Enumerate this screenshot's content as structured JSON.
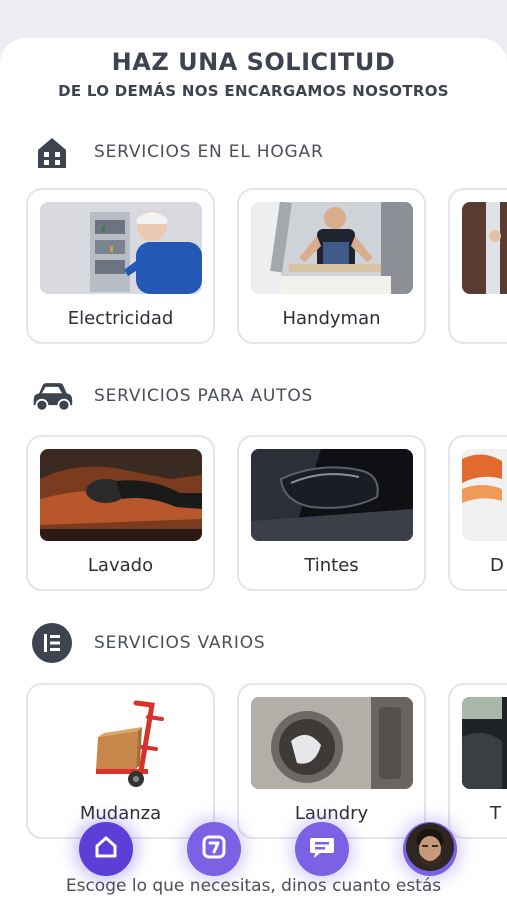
{
  "header": {
    "title": "HAZ UNA SOLICITUD",
    "subtitle": "DE LO DEMÁS NOS ENCARGAMOS NOSOTROS"
  },
  "sections": [
    {
      "label": "SERVICIOS EN EL HOGAR",
      "icon": "house-icon",
      "cards": [
        {
          "label": "Electricidad",
          "image": "electrician-photo"
        },
        {
          "label": "Handyman",
          "image": "handyman-photo"
        },
        {
          "label": "",
          "image": "partial-service-photo"
        }
      ]
    },
    {
      "label": "SERVICIOS PARA AUTOS",
      "icon": "car-icon",
      "cards": [
        {
          "label": "Lavado",
          "image": "car-wash-photo"
        },
        {
          "label": "Tintes",
          "image": "window-tint-photo"
        },
        {
          "label": "D",
          "image": "partial-auto-photo"
        }
      ]
    },
    {
      "label": "SERVICIOS VARIOS",
      "icon": "list-icon",
      "cards": [
        {
          "label": "Mudanza",
          "image": "hand-truck-photo"
        },
        {
          "label": "Laundry",
          "image": "washing-machine-photo"
        },
        {
          "label": "T",
          "image": "partial-misc-photo"
        }
      ]
    }
  ],
  "nav": {
    "items": [
      "home-icon",
      "command-icon",
      "chat-icon",
      "profile-avatar"
    ],
    "accent": "#5b3fd6"
  },
  "footer": {
    "text": "Escoge lo que necesitas, dinos cuanto estás"
  }
}
